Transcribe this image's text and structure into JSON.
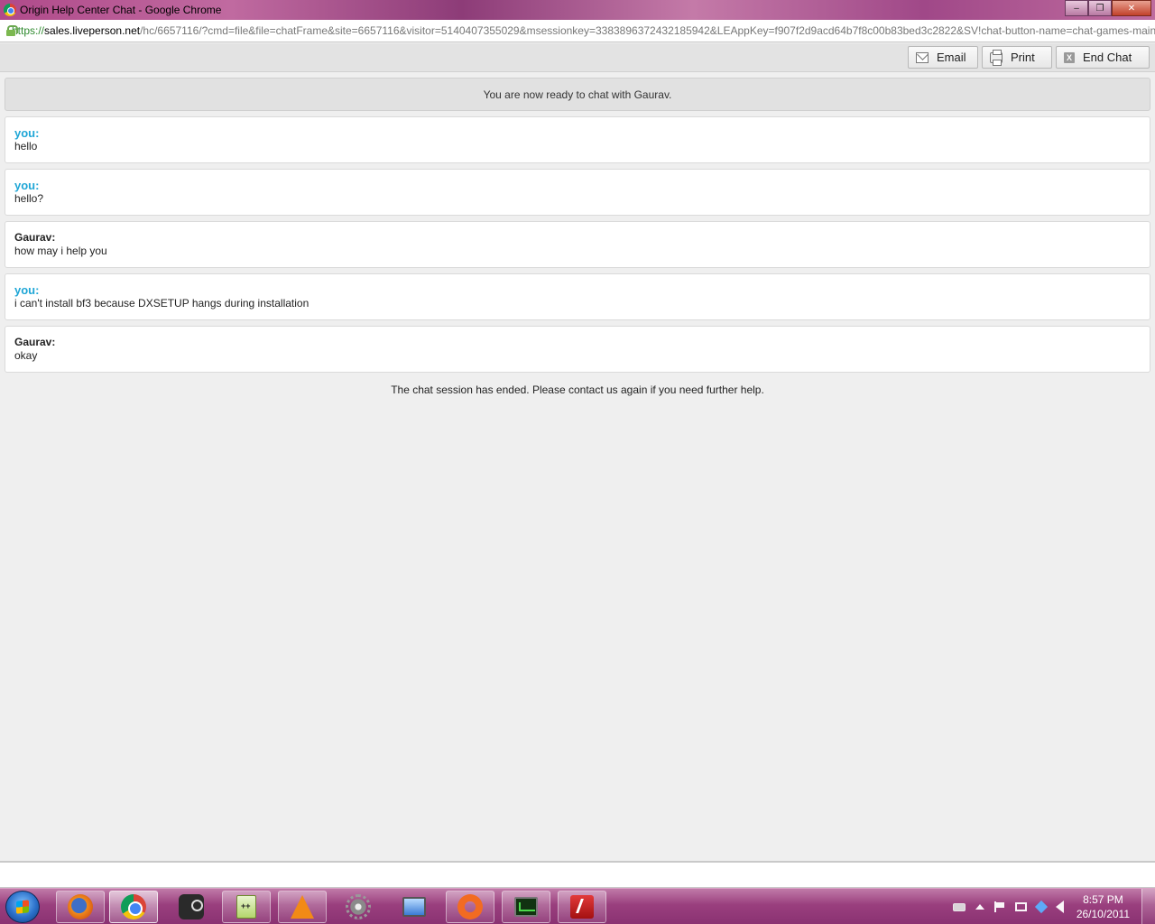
{
  "window": {
    "title": "Origin Help Center Chat - Google Chrome",
    "controls": {
      "minimize": "‒",
      "maximize": "❐",
      "close": "✕"
    }
  },
  "address": {
    "scheme": "https://",
    "host": "sales.liveperson.net",
    "path": "/hc/6657116/?cmd=file&file=chatFrame&site=6657116&visitor=5140407355029&msessionkey=3383896372432185942&LEAppKey=f907f2d9acd64b7f8c00b83bed3c2822&SV!chat-button-name=chat-games-main"
  },
  "toolbar": {
    "email_label": "Email",
    "print_label": "Print",
    "end_chat_label": "End Chat",
    "end_chat_glyph": "X"
  },
  "chat": {
    "system_banner": "You are now ready to chat with Gaurav.",
    "messages": [
      {
        "sender": "you:",
        "text": "hello"
      },
      {
        "sender": "you:",
        "text": "hello?"
      },
      {
        "sender": "Gaurav:",
        "text": "how may i help you"
      },
      {
        "sender": "you:",
        "text": "i can't install bf3 because DXSETUP hangs during installation"
      },
      {
        "sender": "Gaurav:",
        "text": "okay"
      }
    ],
    "ended_notice": "The chat session has ended. Please contact us again if you need further help."
  },
  "taskbar": {
    "apps": [
      "firefox-icon",
      "chrome-icon",
      "steam-icon",
      "notepad-plus-plus-icon",
      "vlc-icon",
      "gear-icon",
      "monitor-icon",
      "origin-icon",
      "task-manager-icon",
      "flash-icon"
    ],
    "clock_time": "8:57 PM",
    "clock_date": "26/10/2011"
  },
  "colors": {
    "you_sender": "#1fa6d6",
    "agent_sender": "#222222",
    "taskbar": "#9a3f7e"
  }
}
